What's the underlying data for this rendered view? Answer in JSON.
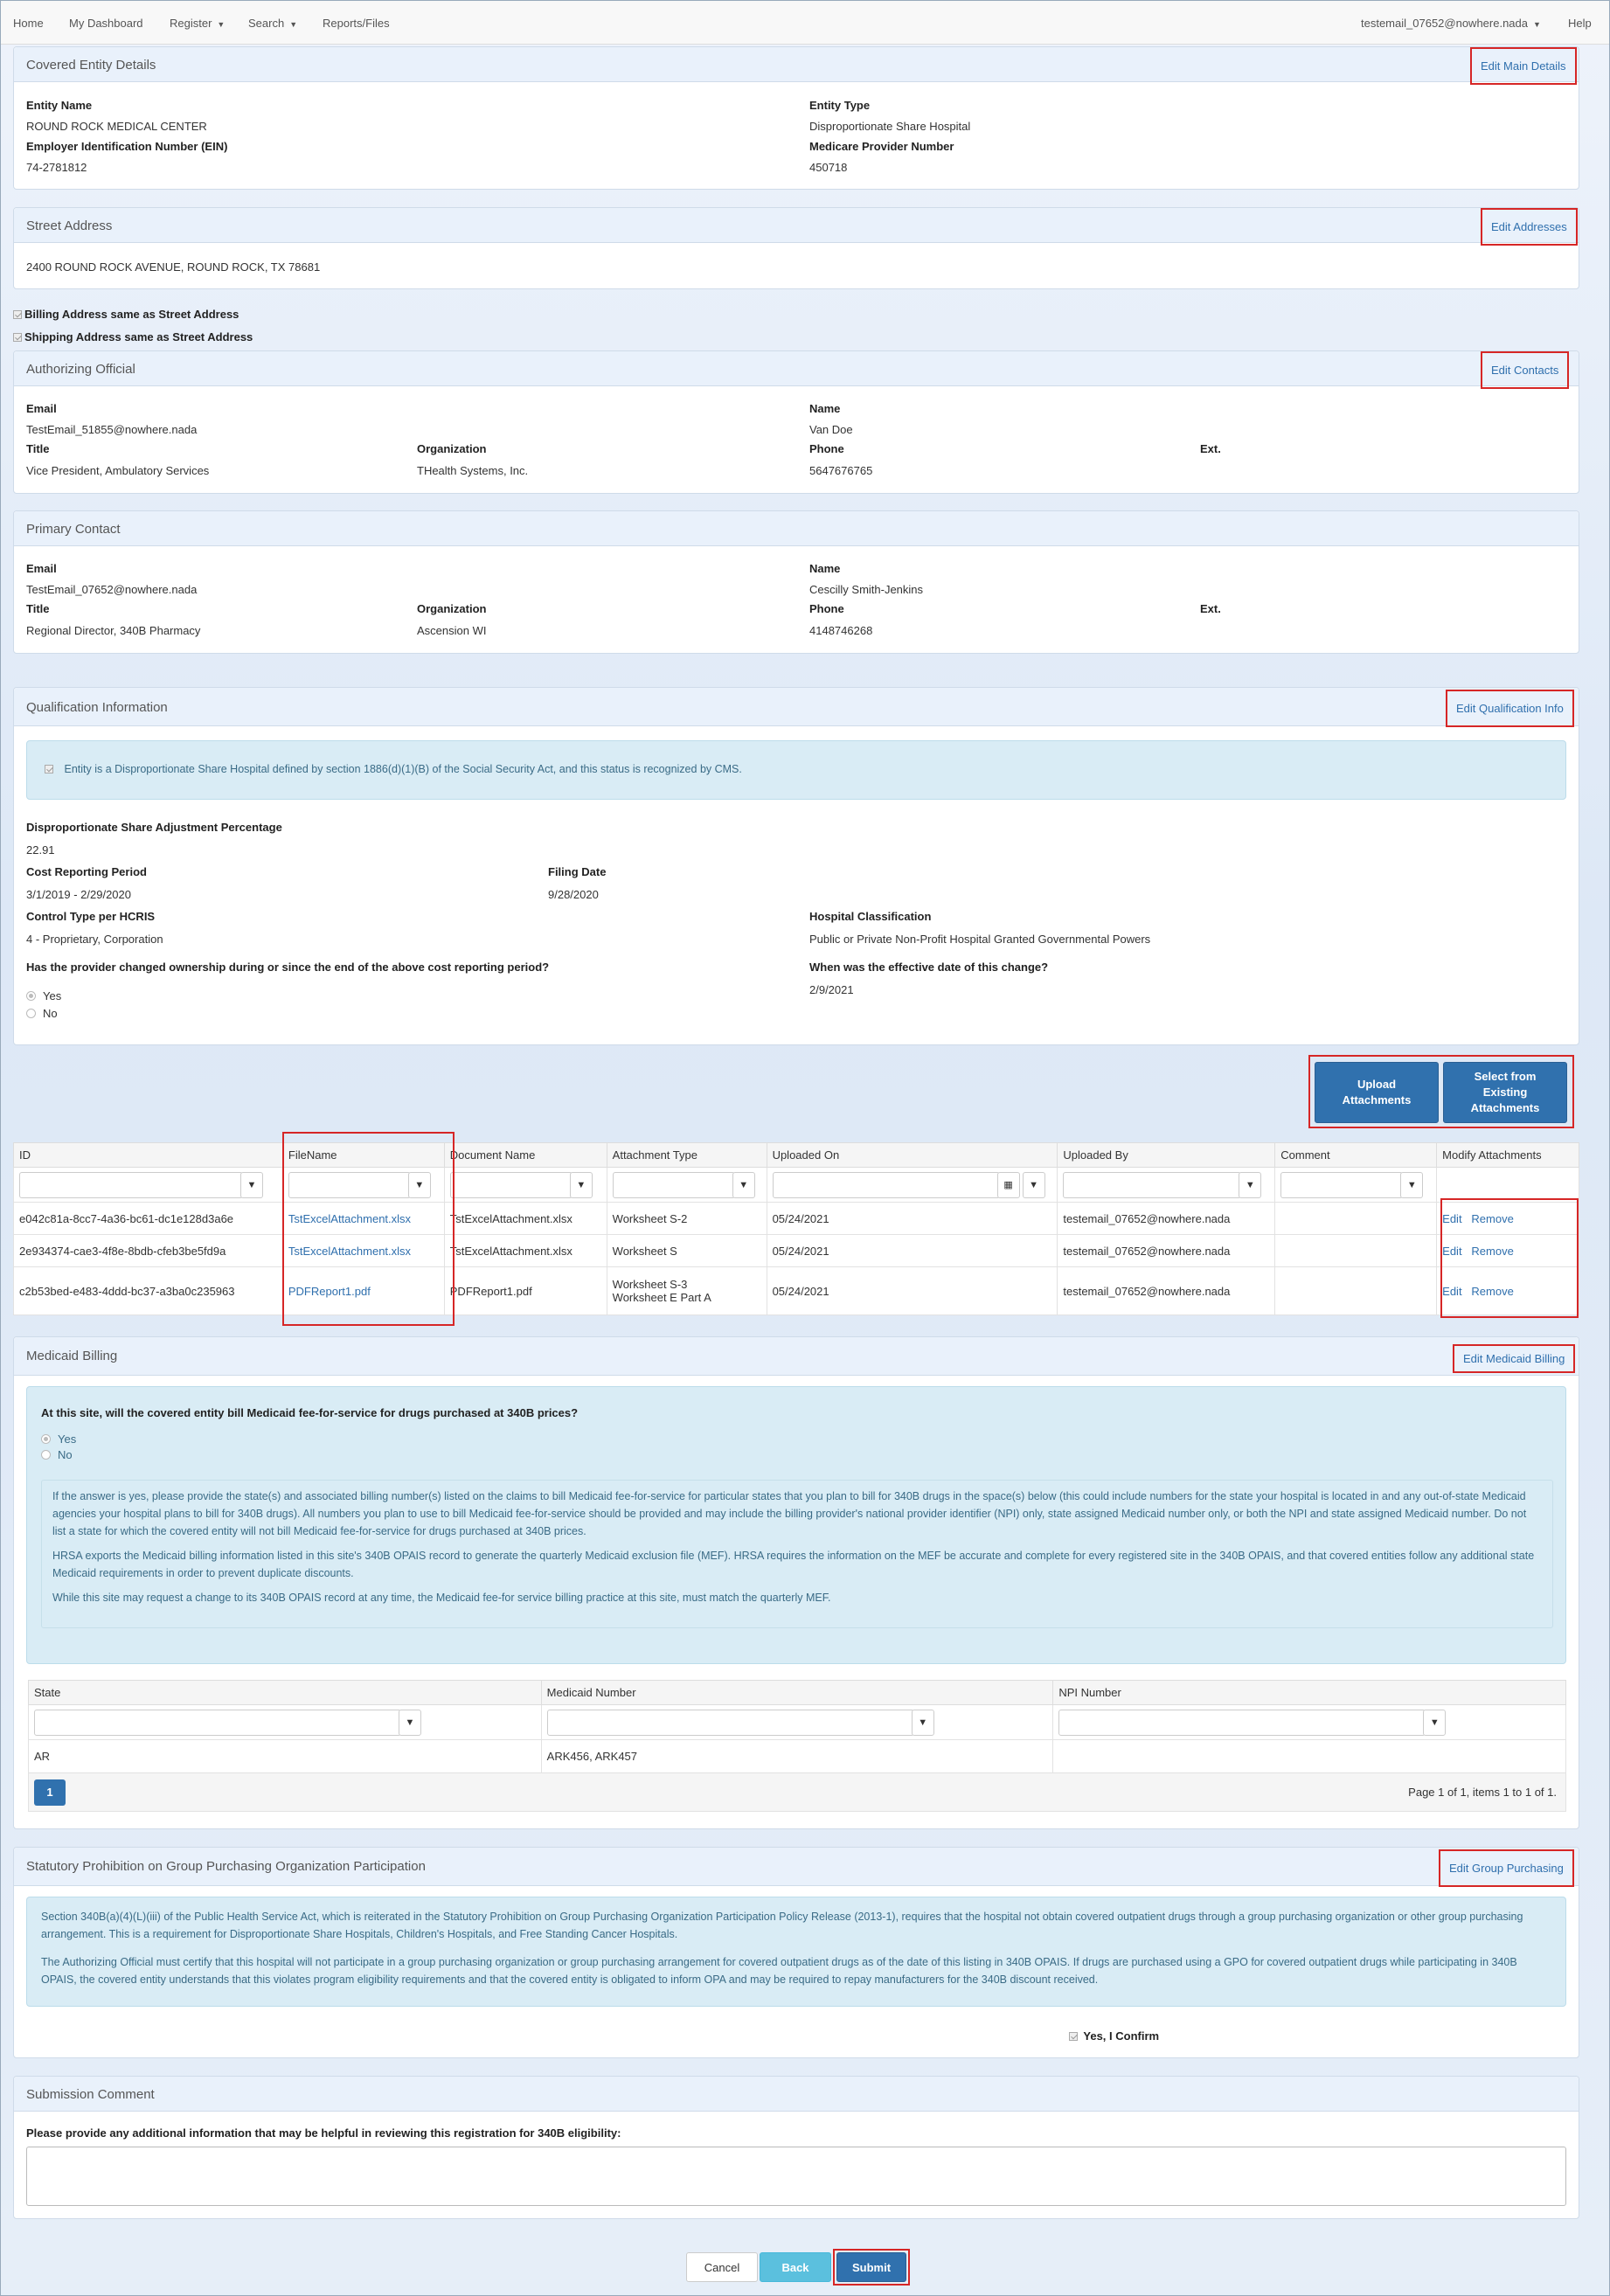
{
  "nav": {
    "home": "Home",
    "dashboard": "My Dashboard",
    "register": "Register",
    "search": "Search",
    "reports": "Reports/Files",
    "user": "testemail_07652@nowhere.nada",
    "help": "Help"
  },
  "covered_entity": {
    "title": "Covered Entity Details",
    "edit": "Edit Main Details",
    "entity_name_label": "Entity Name",
    "entity_name": "ROUND ROCK MEDICAL CENTER",
    "entity_type_label": "Entity Type",
    "entity_type": "Disproportionate Share Hospital",
    "ein_label": "Employer Identification Number (EIN)",
    "ein": "74-2781812",
    "medicare_label": "Medicare Provider Number",
    "medicare": "450718"
  },
  "street_address": {
    "title": "Street Address",
    "edit": "Edit Addresses",
    "address": "2400 ROUND ROCK AVENUE, ROUND ROCK, TX 78681",
    "billing_same": "Billing Address same as Street Address",
    "shipping_same": "Shipping Address same as Street Address"
  },
  "authorizing_official": {
    "title": "Authorizing Official",
    "edit": "Edit Contacts",
    "email_label": "Email",
    "email": "TestEmail_51855@nowhere.nada",
    "name_label": "Name",
    "name": "Van Doe",
    "title_label": "Title",
    "job_title": "Vice President, Ambulatory Services",
    "org_label": "Organization",
    "org": "THealth Systems, Inc.",
    "phone_label": "Phone",
    "phone": "5647676765",
    "ext_label": "Ext."
  },
  "primary_contact": {
    "title": "Primary Contact",
    "email_label": "Email",
    "email": "TestEmail_07652@nowhere.nada",
    "name_label": "Name",
    "name": "Cescilly Smith-Jenkins",
    "title_label": "Title",
    "job_title": "Regional Director, 340B Pharmacy",
    "org_label": "Organization",
    "org": "Ascension WI",
    "phone_label": "Phone",
    "phone": "4148746268",
    "ext_label": "Ext."
  },
  "qualification": {
    "title": "Qualification Information",
    "edit": "Edit Qualification Info",
    "statement": "Entity is a Disproportionate Share Hospital defined by section 1886(d)(1)(B) of the Social Security Act, and this status is recognized by CMS.",
    "dsa_label": "Disproportionate Share Adjustment Percentage",
    "dsa": "22.91",
    "crp_label": "Cost Reporting Period",
    "crp": "3/1/2019 - 2/29/2020",
    "filing_label": "Filing Date",
    "filing": "9/28/2020",
    "control_label": "Control Type per HCRIS",
    "control": "4 - Proprietary, Corporation",
    "class_label": "Hospital Classification",
    "class": "Public or Private Non-Profit Hospital Granted Governmental Powers",
    "ownership_q": "Has the provider changed ownership during or since the end of the above cost reporting period?",
    "yes": "Yes",
    "no": "No",
    "effective_label": "When was the effective date of this change?",
    "effective": "2/9/2021"
  },
  "attachments": {
    "upload_btn": "Upload Attachments",
    "select_btn": "Select from Existing Attachments",
    "columns": [
      "ID",
      "FileName",
      "Document Name",
      "Attachment Type",
      "Uploaded On",
      "Uploaded By",
      "Comment",
      "Modify Attachments"
    ],
    "rows": [
      {
        "id": "e042c81a-8cc7-4a36-bc61-dc1e128d3a6e",
        "file": "TstExcelAttachment.xlsx",
        "doc": "TstExcelAttachment.xlsx",
        "type": "Worksheet S-2",
        "type2": "",
        "on": "05/24/2021",
        "by": "testemail_07652@nowhere.nada",
        "comment": ""
      },
      {
        "id": "2e934374-cae3-4f8e-8bdb-cfeb3be5fd9a",
        "file": "TstExcelAttachment.xlsx",
        "doc": "TstExcelAttachment.xlsx",
        "type": "Worksheet S",
        "type2": "",
        "on": "05/24/2021",
        "by": "testemail_07652@nowhere.nada",
        "comment": ""
      },
      {
        "id": "c2b53bed-e483-4ddd-bc37-a3ba0c235963",
        "file": "PDFReport1.pdf",
        "doc": "PDFReport1.pdf",
        "type": "Worksheet S-3",
        "type2": "Worksheet E Part A",
        "on": "05/24/2021",
        "by": "testemail_07652@nowhere.nada",
        "comment": ""
      }
    ],
    "edit": "Edit",
    "remove": "Remove"
  },
  "medicaid": {
    "title": "Medicaid Billing",
    "edit": "Edit Medicaid Billing",
    "question": "At this site, will the covered entity bill Medicaid fee-for-service for drugs purchased at 340B prices?",
    "yes": "Yes",
    "no": "No",
    "p1": "If the answer is yes, please provide the state(s) and associated billing number(s) listed on the claims to bill Medicaid fee-for-service for particular states that you plan to bill for 340B drugs in the space(s) below (this could include numbers for the state your hospital is located in and any out-of-state Medicaid agencies your hospital plans to bill for 340B drugs). All numbers you plan to use to bill Medicaid fee-for-service should be provided and may include the billing provider's national provider identifier (NPI) only, state assigned Medicaid number only, or both the NPI and state assigned Medicaid number. Do not list a state for which the covered entity will not bill Medicaid fee-for-service for drugs purchased at 340B prices.",
    "p2": "HRSA exports the Medicaid billing information listed in this site's 340B OPAIS record to generate the quarterly Medicaid exclusion file (MEF). HRSA requires the information on the MEF be accurate and complete for every registered site in the 340B OPAIS, and that covered entities follow any additional state Medicaid requirements in order to prevent duplicate discounts.",
    "p3": "While this site may request a change to its 340B OPAIS record at any time, the Medicaid fee-for service billing practice at this site, must match the quarterly MEF.",
    "columns": [
      "State",
      "Medicaid Number",
      "NPI Number"
    ],
    "rows": [
      {
        "state": "AR",
        "number": "ARK456, ARK457",
        "npi": ""
      }
    ],
    "page": "1",
    "paging_info": "Page 1 of 1, items 1 to 1 of 1."
  },
  "gpo": {
    "title": "Statutory Prohibition on Group Purchasing Organization Participation",
    "edit": "Edit Group Purchasing",
    "p1": "Section 340B(a)(4)(L)(iii) of the Public Health Service Act, which is reiterated in the Statutory Prohibition on Group Purchasing Organization Participation Policy Release (2013-1), requires that the hospital not obtain covered outpatient drugs through a group purchasing organization or other group purchasing arrangement. This is a requirement for Disproportionate Share Hospitals, Children's Hospitals, and Free Standing Cancer Hospitals.",
    "p2": "The Authorizing Official must certify that this hospital will not participate in a group purchasing organization or group purchasing arrangement for covered outpatient drugs as of the date of this listing in 340B OPAIS. If drugs are purchased using a GPO for covered outpatient drugs while participating in 340B OPAIS, the covered entity understands that this violates program eligibility requirements and that the covered entity is obligated to inform OPA and may be required to repay manufacturers for the 340B discount received.",
    "confirm": "Yes, I Confirm"
  },
  "submission": {
    "title": "Submission Comment",
    "prompt": "Please provide any additional information that may be helpful in reviewing this registration for 340B eligibility:"
  },
  "footer": {
    "cancel": "Cancel",
    "back": "Back",
    "submit": "Submit"
  },
  "colors": {
    "accent": "#3071ae",
    "highlight": "#d62626",
    "back_button": "#5bc0de"
  },
  "icons": {
    "filter": "funnel-icon",
    "calendar": "calendar-icon",
    "caret": "caret-down-icon",
    "checkbox": "checkbox-checked-icon"
  }
}
